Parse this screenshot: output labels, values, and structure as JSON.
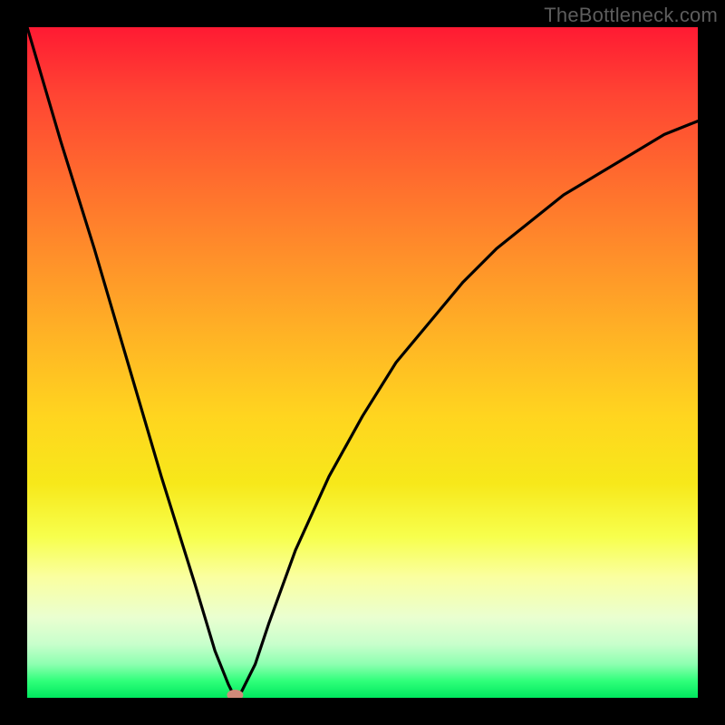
{
  "watermark": "TheBottleneck.com",
  "chart_data": {
    "type": "line",
    "title": "",
    "xlabel": "",
    "ylabel": "",
    "xlim": [
      0,
      100
    ],
    "ylim": [
      0,
      100
    ],
    "grid": false,
    "series": [
      {
        "name": "bottleneck-curve",
        "x": [
          0,
          5,
          10,
          15,
          20,
          25,
          28,
          30,
          31,
          32,
          34,
          36,
          40,
          45,
          50,
          55,
          60,
          65,
          70,
          75,
          80,
          85,
          90,
          95,
          100
        ],
        "values": [
          100,
          83,
          67,
          50,
          33,
          17,
          7,
          2,
          0,
          1,
          5,
          11,
          22,
          33,
          42,
          50,
          56,
          62,
          67,
          71,
          75,
          78,
          81,
          84,
          86
        ]
      }
    ],
    "marker": {
      "x": 31,
      "y": 0,
      "color": "#d08a7a"
    },
    "background_gradient_stops": [
      {
        "pct": 0,
        "color": "#ff1a33"
      },
      {
        "pct": 50,
        "color": "#ffd51f"
      },
      {
        "pct": 80,
        "color": "#f7ff70"
      },
      {
        "pct": 100,
        "color": "#00e85e"
      }
    ]
  }
}
